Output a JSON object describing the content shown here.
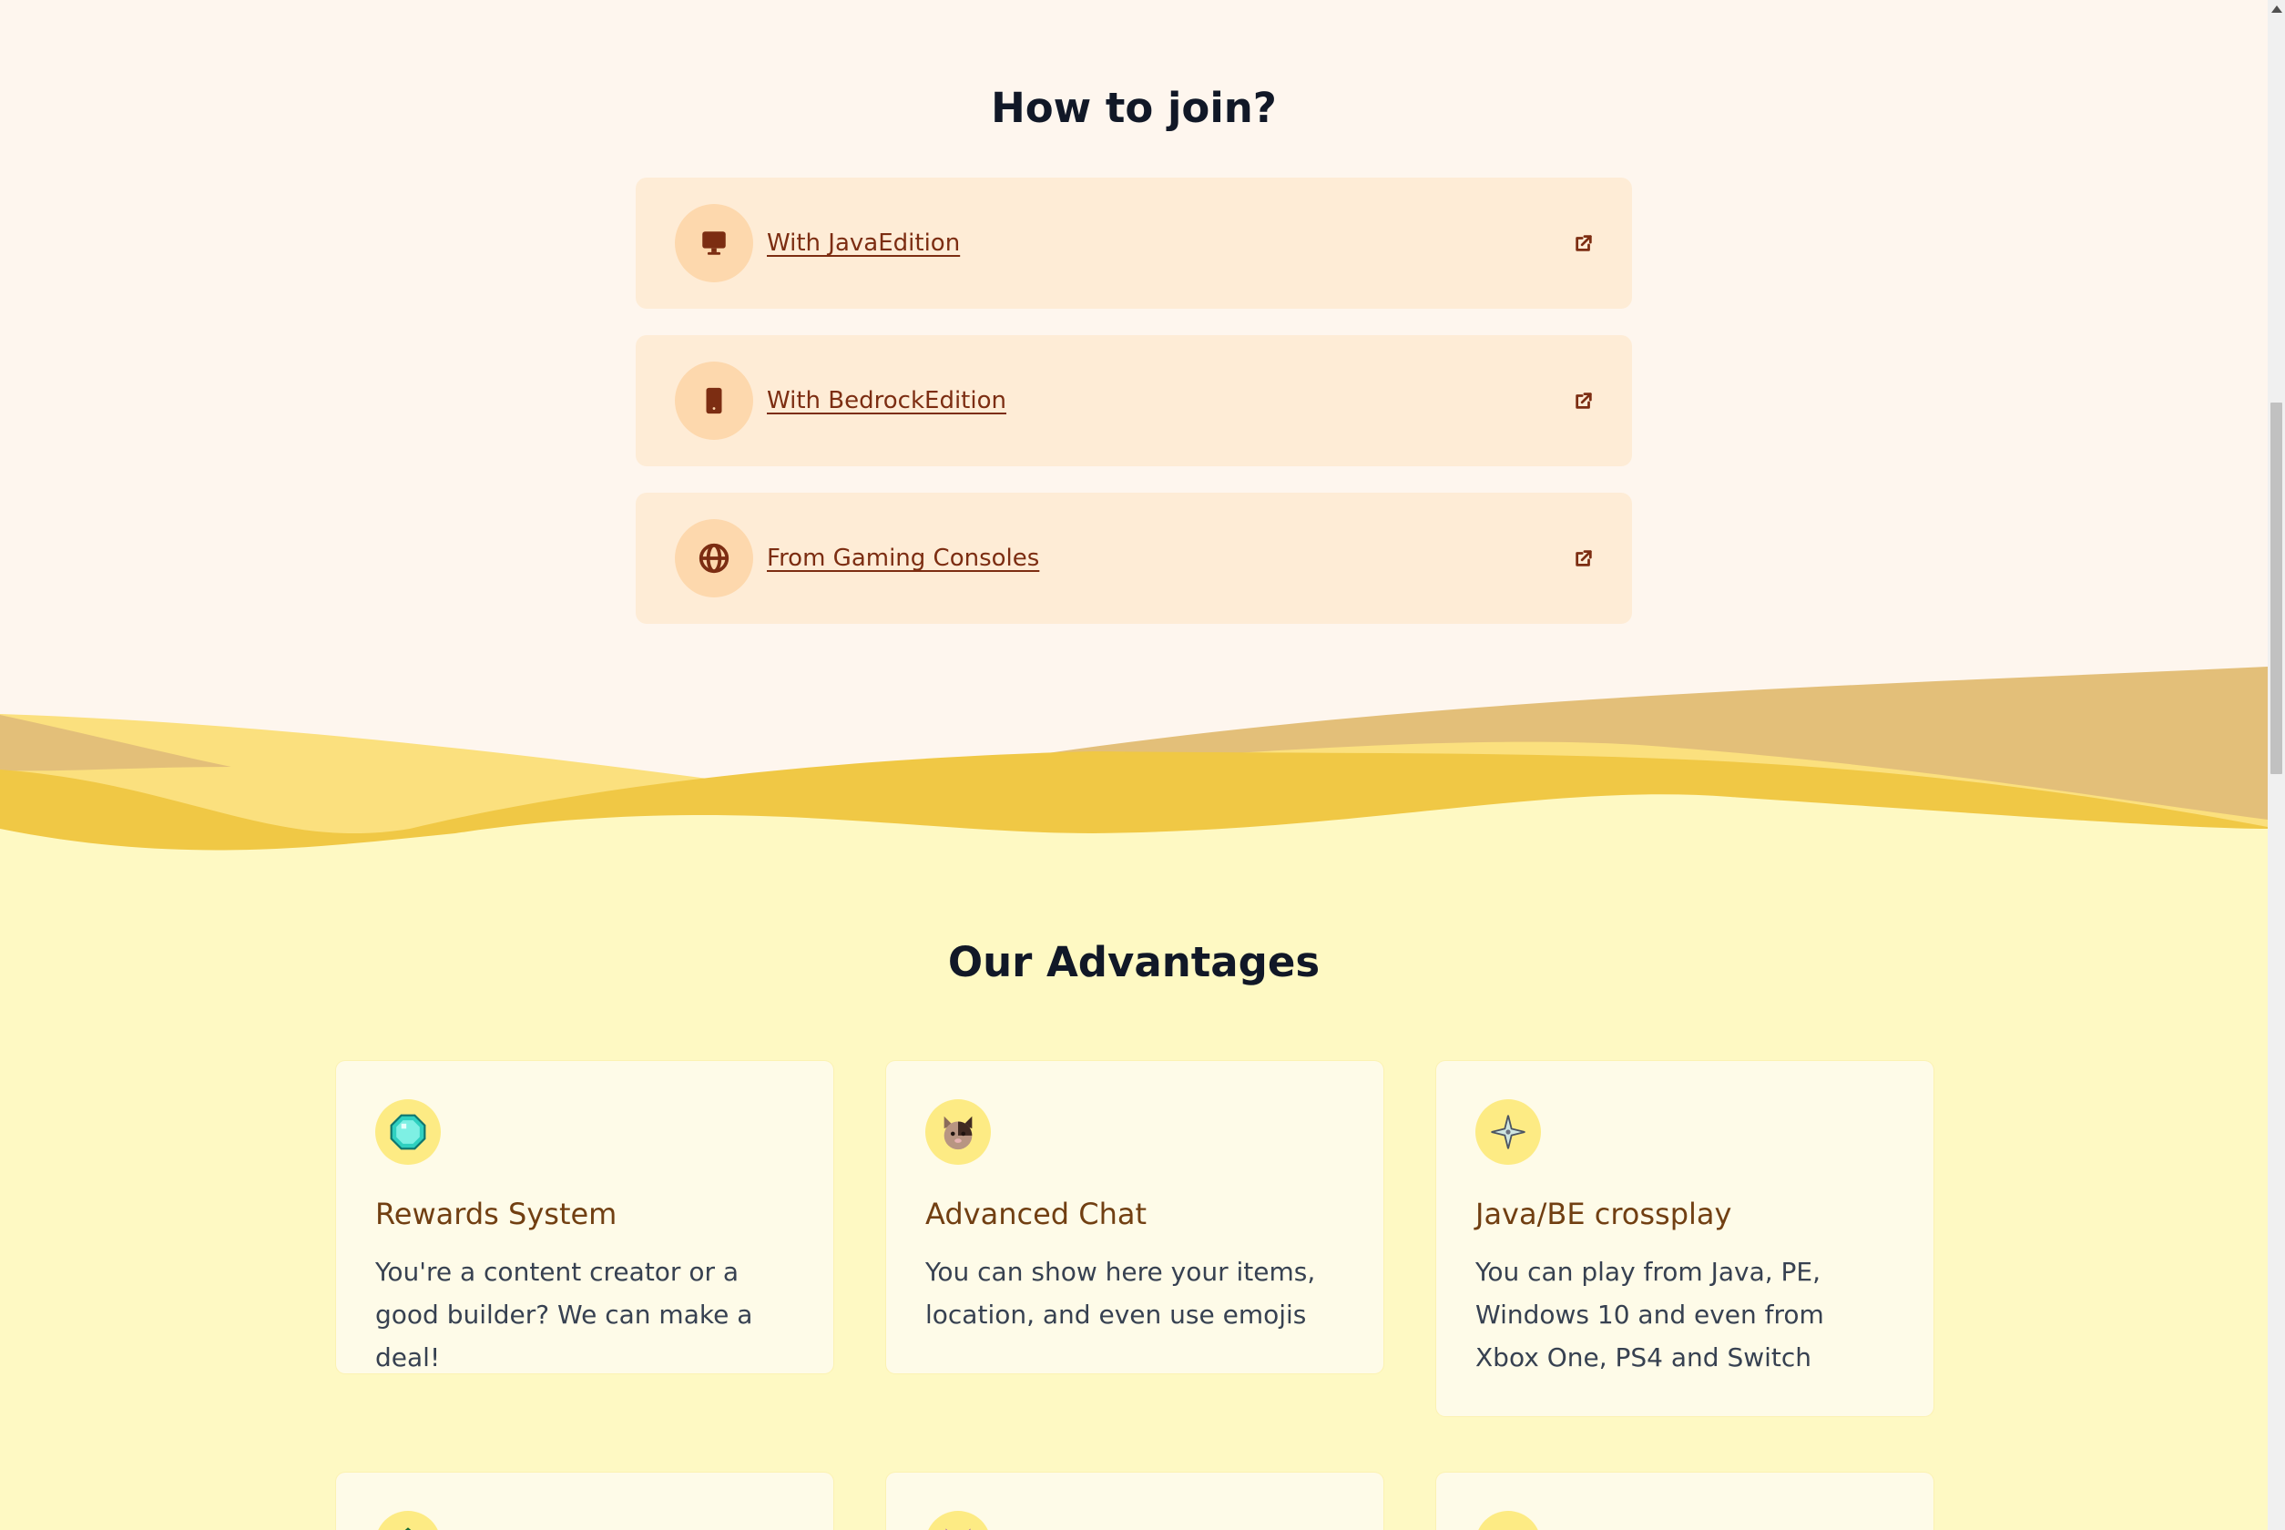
{
  "join": {
    "title": "How to join?",
    "items": [
      {
        "label": "With JavaEdition",
        "icon": "monitor-icon"
      },
      {
        "label": "With BedrockEdition",
        "icon": "smartphone-icon"
      },
      {
        "label": "From Gaming Consoles",
        "icon": "globe-icon"
      }
    ]
  },
  "advantages": {
    "title": "Our Advantages",
    "items": [
      {
        "title": "Rewards System",
        "text": "You're a content creator or a good builder? We can make a deal!",
        "icon": "diamond-icon"
      },
      {
        "title": "Advanced Chat",
        "text": "You can show here your items, location, and even use emojis",
        "icon": "cat-emoji-icon"
      },
      {
        "title": "Java/BE crossplay",
        "text": "You can play from Java, PE, Windows 10 and even from Xbox One, PS4 and Switch",
        "icon": "sparkle-icon"
      }
    ]
  },
  "colors": {
    "page_background": "#fef6ee",
    "join_card": "#feecd6",
    "join_icon_circle": "#fdd8ad",
    "link": "#7c2d12",
    "advantages_background": "#fef9c3",
    "advantage_card": "#fefbe8",
    "advantage_icon_circle": "#fdeb84",
    "wave_tan": "#e3bf79",
    "wave_gold": "#f0c845",
    "wave_light": "#fbe07e"
  }
}
